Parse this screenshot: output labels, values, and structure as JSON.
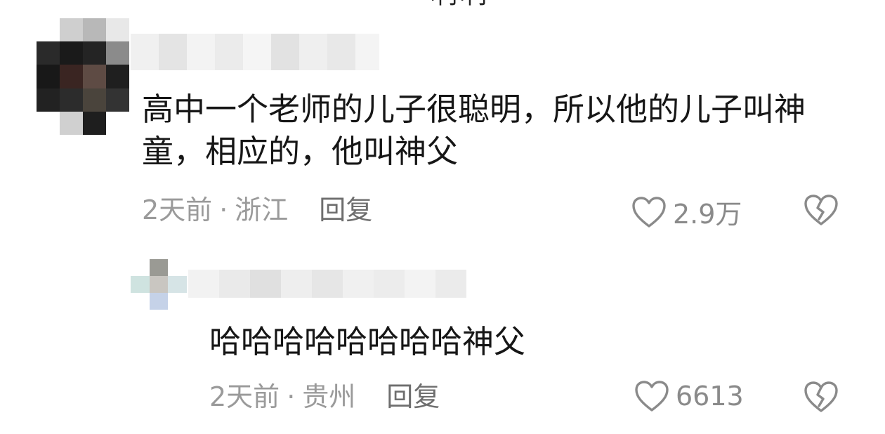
{
  "top_fragment": "啊啊",
  "comments": [
    {
      "text": "高中一个老师的儿子很聪明，所以他的儿子叫神童，相应的，他叫神父",
      "time": "2天前",
      "separator": "·",
      "location": "浙江",
      "reply_label": "回复",
      "likes": "2.9万"
    },
    {
      "text": "哈哈哈哈哈哈哈哈神父",
      "time": "2天前",
      "separator": "·",
      "location": "贵州",
      "reply_label": "回复",
      "likes": "6613"
    }
  ],
  "icons": {
    "like": "heart-outline-icon",
    "dislike": "broken-heart-icon"
  },
  "colors": {
    "text": "#161616",
    "meta": "#9a9a9a",
    "reply": "#6e6e6e",
    "icon": "#8a8a8a"
  }
}
